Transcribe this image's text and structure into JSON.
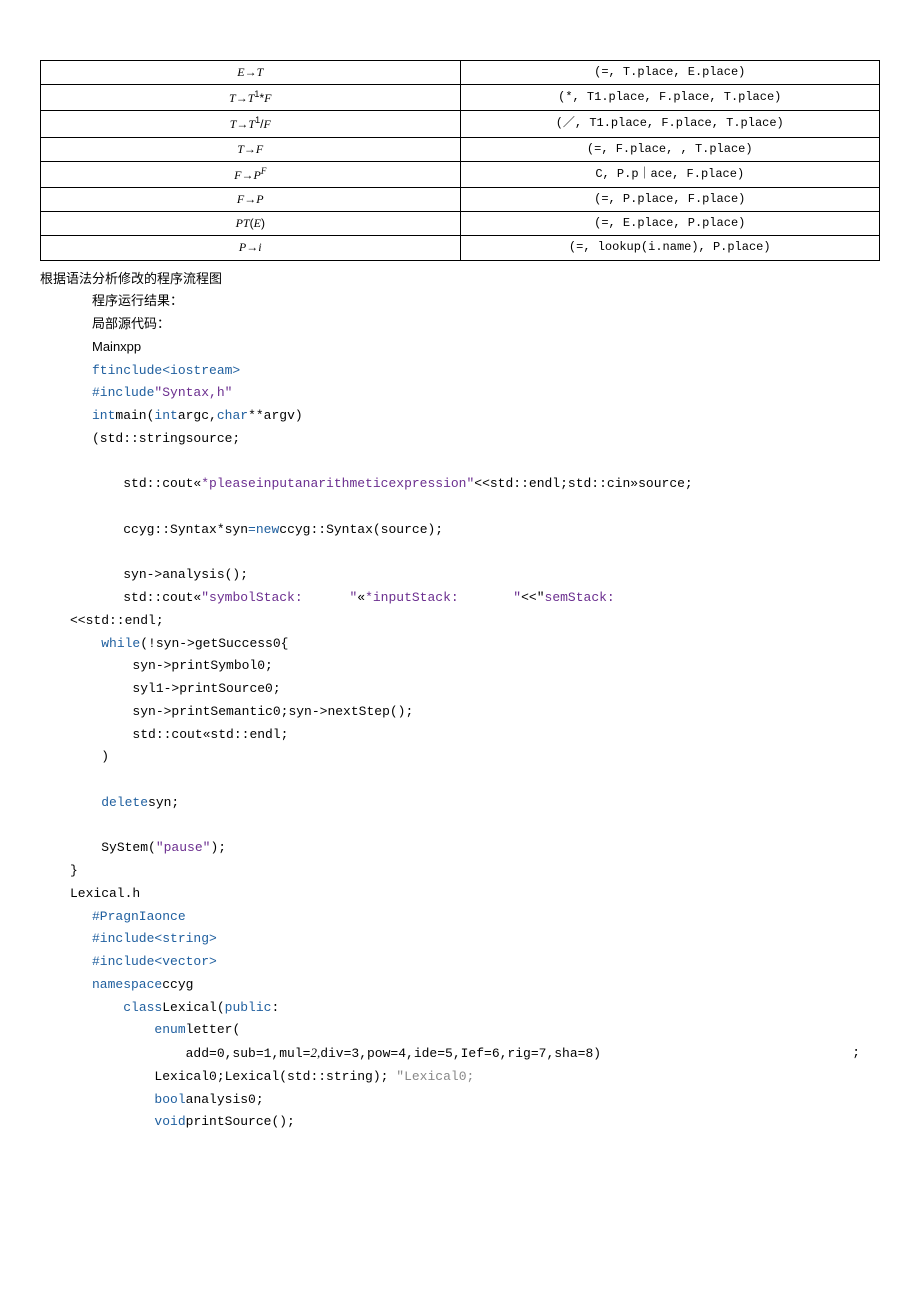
{
  "table": {
    "rows": [
      {
        "l": "E→T",
        "r": "(=, T.place, E.place)"
      },
      {
        "l": "T→T¹*F",
        "r": "(*, T1.place, F.place, T.place)"
      },
      {
        "l": "T→T¹/F",
        "r": "(／, T1.place, F.place, T.place)"
      },
      {
        "l": "T→F",
        "r": "(=, F.place, , T.place)"
      },
      {
        "l": "F→Pᶠ",
        "r": "C, P.p｜ace, F.place)"
      },
      {
        "l": "F→P",
        "r": "(=, P.place, F.place)"
      },
      {
        "l": "PT(E)",
        "r": "(=, E.place, P.place)"
      },
      {
        "l": "P→i",
        "r": "(=, lookup(i.name), P.place)"
      }
    ]
  },
  "texts": {
    "heading1": "根据语法分析修改的程序流程图",
    "line1": "程序运行结果：",
    "line2": "局部源代码：",
    "line3": "Mainxpp",
    "line4": "Lexical.h"
  },
  "code1": {
    "l1a": "ftinclude",
    "l1b": "<iostream>",
    "l2a": "#include",
    "l2b": "\"Syntax,h\"",
    "l3a": "int",
    "l3b": "main(",
    "l3c": "int",
    "l3d": "argc,",
    "l3e": "char",
    "l3f": "**argv)",
    "l4a": "(std::stringsource;",
    "l5a": "std::cout«",
    "l5b": "*pleaseinputanarithmeticexpression\"",
    "l5c": "<<std::endl;std::cin»source;",
    "l6a": "ccyg::Syntax*syn",
    "l6b": "=new",
    "l6c": "ccyg::Syntax(source);",
    "l7a": "syn->analysis();",
    "l8a": "std::cout«",
    "l8b": "\"symbolStack:      \"",
    "l8c": "«",
    "l8d": "*inputStack:       \"",
    "l8e": "<<\"",
    "l8f": "semStack:",
    "l9a": "<<std::endl;",
    "l10a": "while",
    "l10b": "(!syn->getSuccess0{",
    "l11a": "syn->printSymbol0;",
    "l12a": "syl1->printSource0;",
    "l13a": "syn->printSemantic0;syn->nextStep();",
    "l14a": "std::cout«std::endl;",
    "l15a": ")",
    "l16a": "delete",
    "l16b": "syn;",
    "l17a": "SyStem(",
    "l17b": "\"pause\"",
    "l17c": ");",
    "l18a": "}"
  },
  "code2": {
    "l1a": "#PragnIaonce",
    "l2a": "#include",
    "l2b": "<string>",
    "l3a": "#include",
    "l3b": "<vector>",
    "l4a": "namespace",
    "l4b": "ccyg",
    "l5a": "class",
    "l5b": "Lexical(",
    "l5c": "public",
    "l5d": ":",
    "l6a": "enum",
    "l6b": "letter(",
    "l7a": "add=0,sub=1,mul=",
    "l7b": "2,",
    "l7c": "div=3,pow=4,ide=5,Ief=6,rig=7,sha=8)",
    "l7d": ";",
    "l8a": "Lexical0;Lexical(std::string);",
    "l8b": "\"Lexical0;",
    "l9a": "bool",
    "l9b": "analysis0;",
    "l10a": "void",
    "l10b": "printSource();"
  }
}
